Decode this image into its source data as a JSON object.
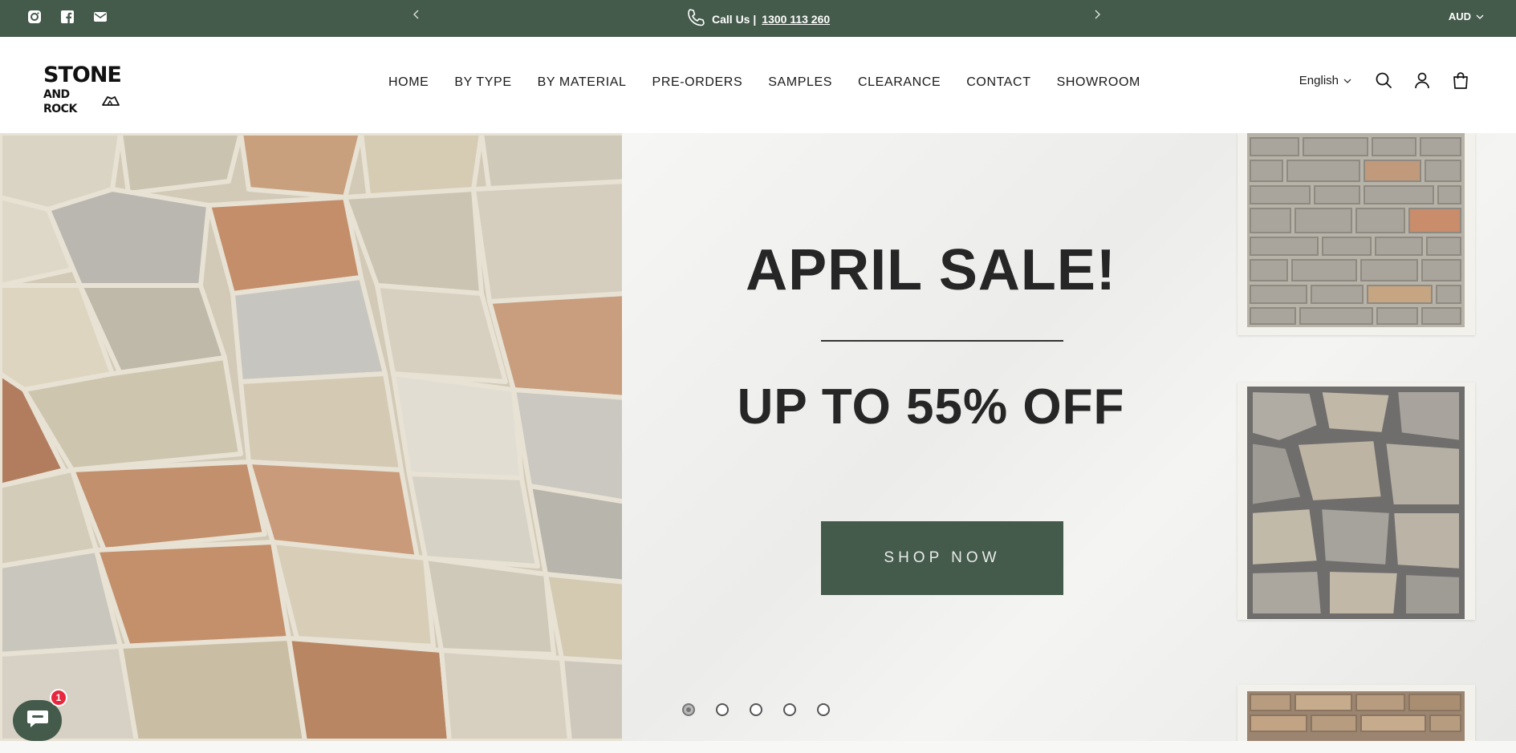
{
  "announcement": {
    "call_label": "Call Us |",
    "phone": "1300 113 260",
    "currency": "AUD",
    "prev_icon": "chevron-left-icon",
    "next_icon": "chevron-right-icon",
    "social_icons": [
      "instagram-icon",
      "facebook-icon",
      "email-icon"
    ]
  },
  "header": {
    "logo_line1": "STONE",
    "logo_line2": "AND ROCK",
    "nav": [
      "HOME",
      "BY TYPE",
      "BY MATERIAL",
      "PRE-ORDERS",
      "SAMPLES",
      "CLEARANCE",
      "CONTACT",
      "SHOWROOM"
    ],
    "language": "English",
    "icons": [
      "search-icon",
      "account-icon",
      "cart-icon"
    ]
  },
  "hero": {
    "headline": "APRIL SALE!",
    "subline": "UP TO 55% OFF",
    "cta": "SHOP NOW",
    "slide_count": 5,
    "active_slide": 1
  },
  "chat": {
    "badge": "1"
  },
  "colors": {
    "brand_green": "#445a4b",
    "badge_red": "#e8283e"
  }
}
